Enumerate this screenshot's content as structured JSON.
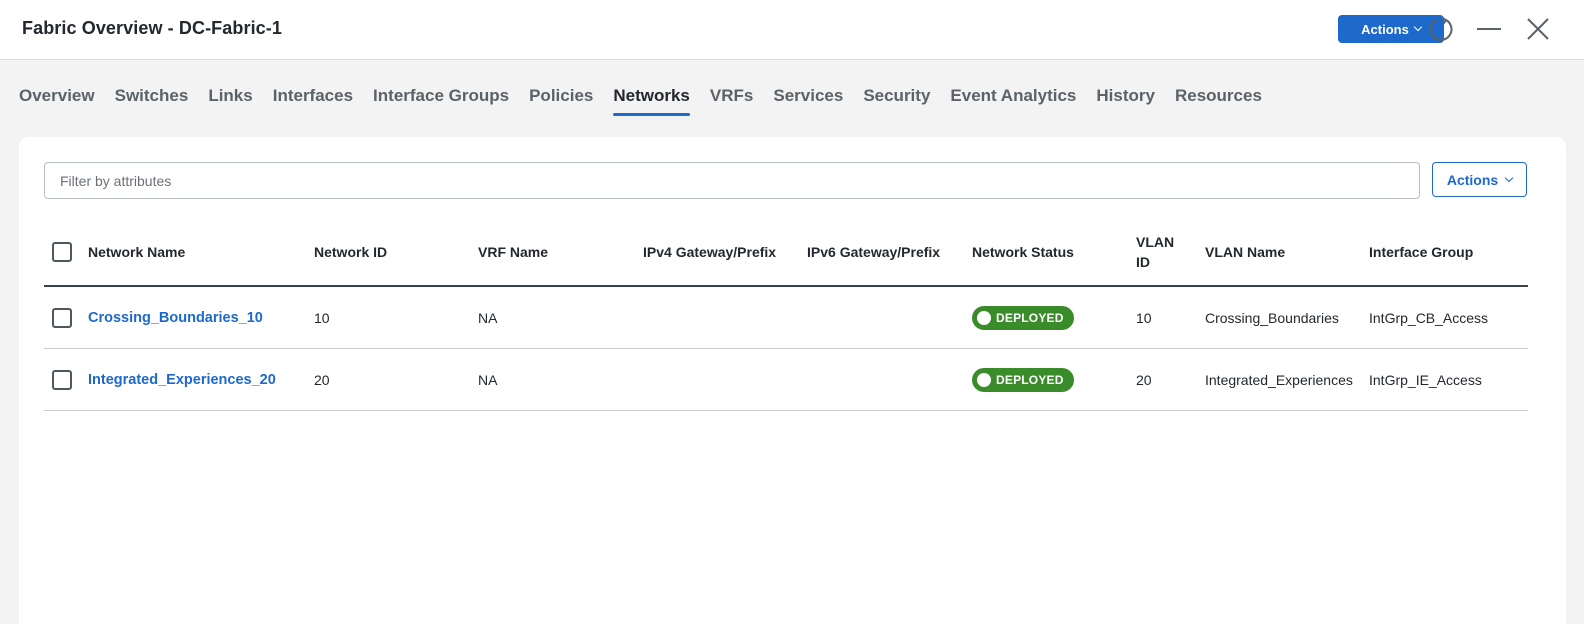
{
  "window": {
    "title": "Fabric Overview - DC-Fabric-1",
    "actions_label": "Actions"
  },
  "tabs": [
    {
      "label": "Overview"
    },
    {
      "label": "Switches"
    },
    {
      "label": "Links"
    },
    {
      "label": "Interfaces"
    },
    {
      "label": "Interface Groups"
    },
    {
      "label": "Policies"
    },
    {
      "label": "Networks",
      "active": true
    },
    {
      "label": "VRFs"
    },
    {
      "label": "Services"
    },
    {
      "label": "Security"
    },
    {
      "label": "Event Analytics"
    },
    {
      "label": "History"
    },
    {
      "label": "Resources"
    }
  ],
  "toolbar": {
    "filter_placeholder": "Filter by attributes",
    "actions_label": "Actions"
  },
  "table": {
    "columns": [
      "Network Name",
      "Network ID",
      "VRF Name",
      "IPv4 Gateway/Prefix",
      "IPv6 Gateway/Prefix",
      "Network Status",
      "VLAN ID",
      "VLAN Name",
      "Interface Group"
    ],
    "rows": [
      {
        "network_name": "Crossing_Boundaries_10",
        "network_id": "10",
        "vrf_name": "NA",
        "ipv4": "",
        "ipv6": "",
        "status": "DEPLOYED",
        "vlan_id": "10",
        "vlan_name": "Crossing_Boundaries",
        "interface_group": "IntGrp_CB_Access"
      },
      {
        "network_name": "Integrated_Experiences_20",
        "network_id": "20",
        "vrf_name": "NA",
        "ipv4": "",
        "ipv6": "",
        "status": "DEPLOYED",
        "vlan_id": "20",
        "vlan_name": "Integrated_Experiences",
        "interface_group": "IntGrp_IE_Access"
      }
    ]
  },
  "colors": {
    "accent": "#1d69cc",
    "status_deployed": "#3a8b2a"
  },
  "icons": {
    "refresh": "refresh-icon",
    "minimize": "minimize-icon",
    "close": "close-icon",
    "dropdown": "chevron-down-icon"
  }
}
